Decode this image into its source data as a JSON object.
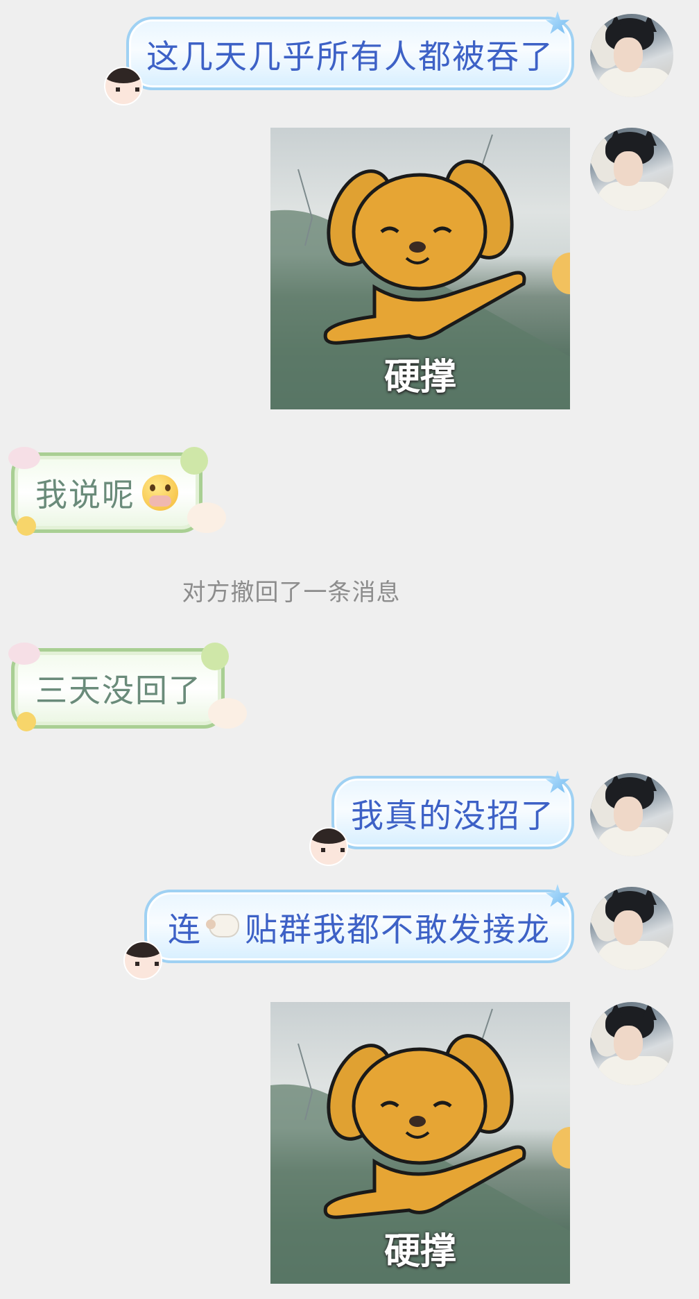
{
  "messages": {
    "m1": "这几天几乎所有人都被吞了",
    "m2_caption": "硬撑",
    "m3": "我说呢",
    "m4": "三天没回了",
    "m5": "我真的没招了",
    "m6_prefix": "连",
    "m6_suffix": "贴群我都不敢发接龙",
    "m7_caption": "硬撑"
  },
  "system_notice": "对方撤回了一条消息",
  "icons": {
    "avatar": "profile-avatar-icon",
    "crying_emoji": "pleading-face-emoji-icon",
    "sheep_emoji": "sheep-emoji-icon"
  },
  "colors": {
    "background": "#efefef",
    "sent_text": "#3d61c6",
    "sent_border": "#9fd1f3",
    "received_text": "#6a8b7a",
    "received_border": "#a9cf93",
    "system_text": "#8c8c8c"
  }
}
